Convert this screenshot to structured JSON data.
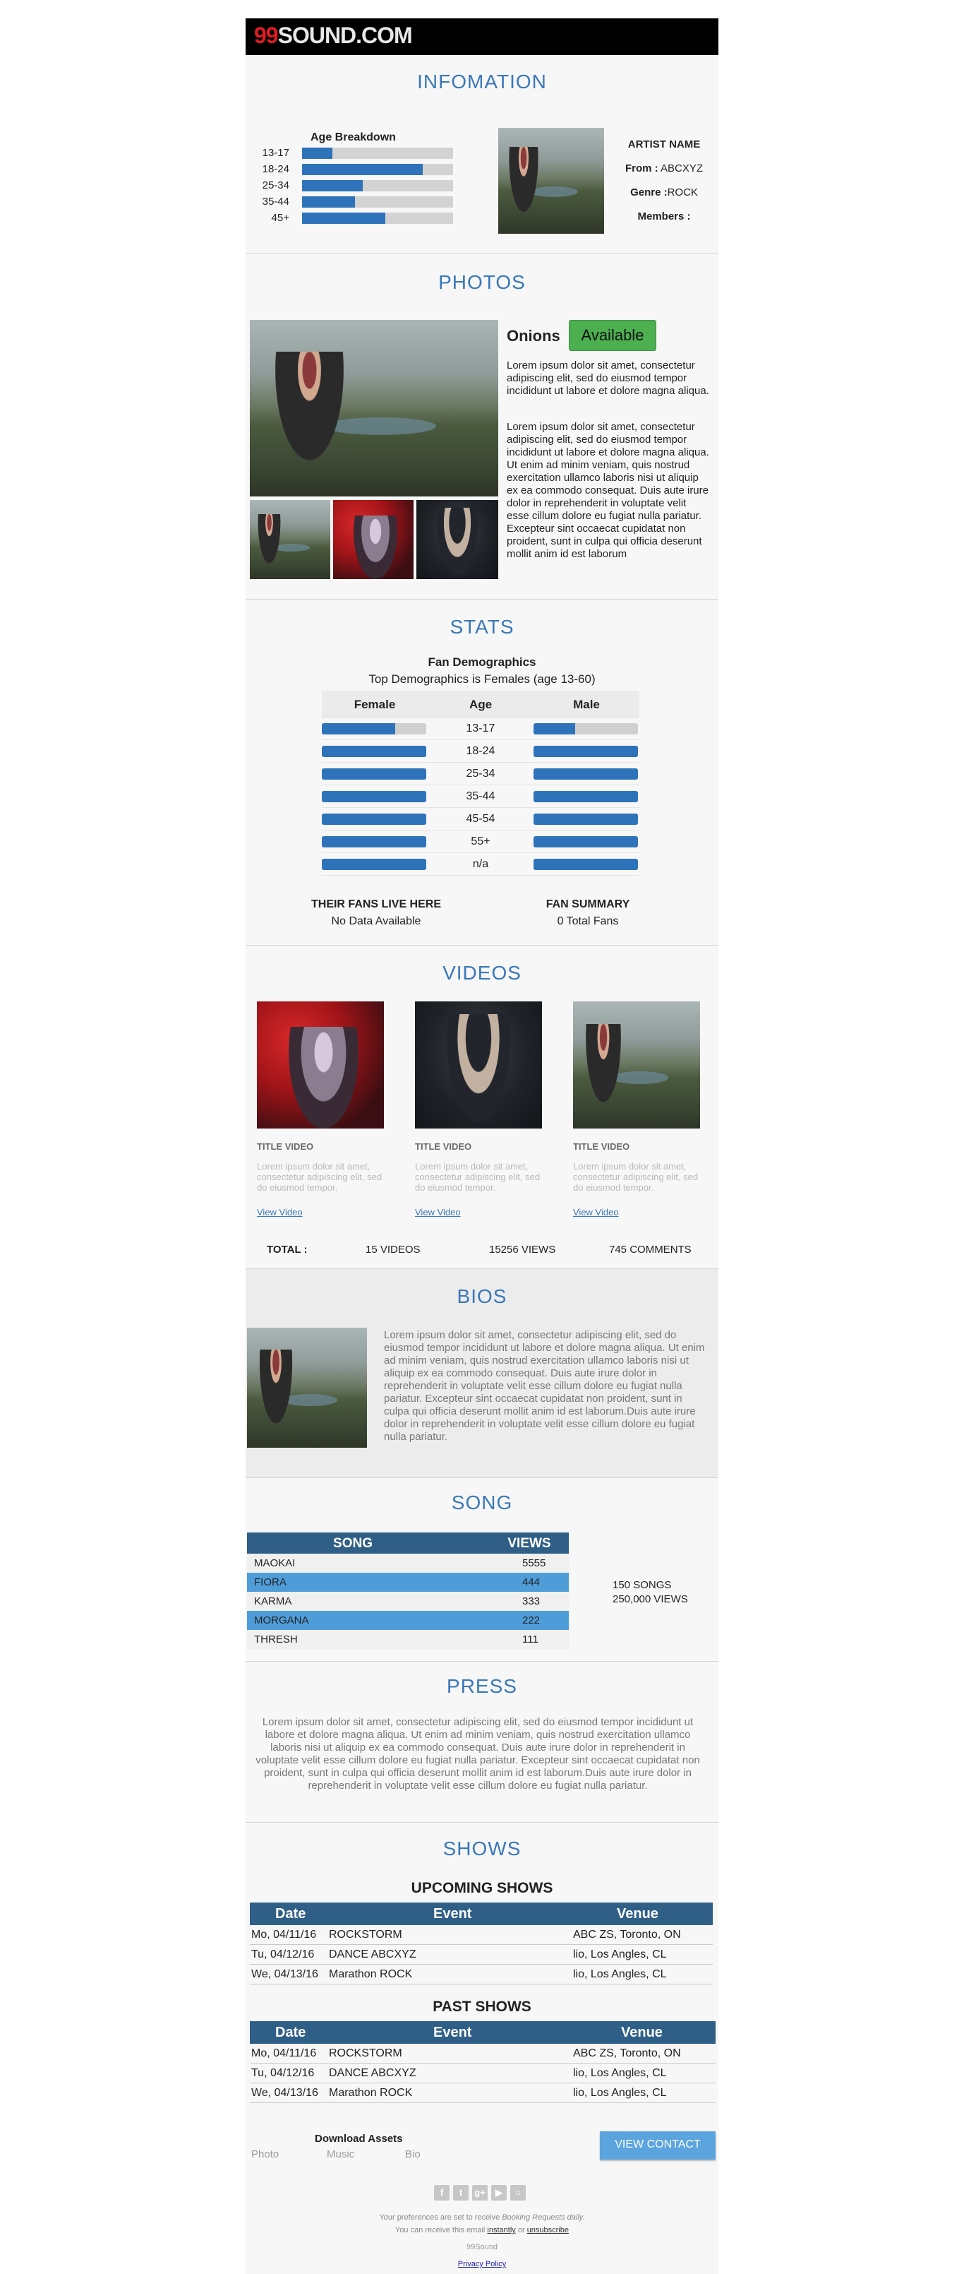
{
  "brand": {
    "digits": "99",
    "word": "SOUND.COM"
  },
  "info": {
    "title": "INFOMATION",
    "age_breakdown": {
      "title": "Age Breakdown",
      "rows": [
        {
          "label": "13-17",
          "value": 0.2
        },
        {
          "label": "18-24",
          "value": 0.8
        },
        {
          "label": "25-34",
          "value": 0.4
        },
        {
          "label": "35-44",
          "value": 0.35
        },
        {
          "label": "45+",
          "value": 0.55
        }
      ]
    },
    "artist_name": "ARTIST NAME",
    "from_label": "From :",
    "from_value": "ABCXYZ",
    "genre_label": "Genre :",
    "genre_value": "ROCK",
    "members_label": "Members :"
  },
  "photos": {
    "title": "PHOTOS",
    "name": "Onions",
    "status": "Available",
    "para1": "Lorem ipsum dolor sit amet, consectetur adipiscing elit, sed do eiusmod tempor incididunt ut labore et dolore magna aliqua.",
    "para2": "Lorem ipsum dolor sit amet, consectetur adipiscing elit, sed do eiusmod tempor incididunt ut labore et dolore magna aliqua. Ut enim ad minim veniam, quis nostrud exercitation ullamco laboris nisi ut aliquip ex ea commodo consequat. Duis aute irure dolor in reprehenderit in voluptate velit esse cillum dolore eu fugiat nulla pariatur. Excepteur sint occaecat cupidatat non proident, sunt in culpa qui officia deserunt mollit anim id est laborum"
  },
  "stats": {
    "title": "STATS",
    "heading": "Fan Demographics",
    "subheading": "Top Demographics is Females (age 13-60)",
    "col_female": "Female",
    "col_age": "Age",
    "col_male": "Male",
    "rows": [
      {
        "age": "13-17",
        "female": 0.7,
        "male": 0.4
      },
      {
        "age": "18-24",
        "female": 1.0,
        "male": 1.0
      },
      {
        "age": "25-34",
        "female": 1.0,
        "male": 1.0
      },
      {
        "age": "35-44",
        "female": 1.0,
        "male": 1.0
      },
      {
        "age": "45-54",
        "female": 1.0,
        "male": 1.0
      },
      {
        "age": "55+",
        "female": 1.0,
        "male": 1.0
      },
      {
        "age": "n/a",
        "female": 1.0,
        "male": 1.0
      }
    ],
    "fans_live_title": "THEIR FANS LIVE HERE",
    "fans_live_value": "No Data Available",
    "fan_summary_title": "FAN SUMMARY",
    "fan_summary_value": "0 Total Fans"
  },
  "videos": {
    "title": "VIDEOS",
    "items": [
      {
        "title": "TITLE VIDEO",
        "desc": "Lorem ipsum dolor sit amet, consectetur adipiscing elit, sed do eiusmod tempor.",
        "link": "View Video"
      },
      {
        "title": "TITLE VIDEO",
        "desc": "Lorem ipsum dolor sit amet, consectetur adipiscing elit, sed do eiusmod tempor.",
        "link": "View Video"
      },
      {
        "title": "TITLE VIDEO",
        "desc": "Lorem ipsum dolor sit amet, consectetur adipiscing elit, sed do eiusmod tempor.",
        "link": "View Video"
      }
    ],
    "total_label": "TOTAL :",
    "total_videos": "15 VIDEOS",
    "total_views": "15256 VIEWS",
    "total_comments": "745 COMMENTS"
  },
  "bios": {
    "title": "BIOS",
    "text": "Lorem ipsum dolor sit amet, consectetur adipiscing elit, sed do eiusmod tempor incididunt ut labore et dolore magna aliqua. Ut enim ad minim veniam, quis nostrud exercitation ullamco laboris nisi ut aliquip ex ea commodo consequat. Duis aute irure dolor in reprehenderit in voluptate velit esse cillum dolore eu fugiat nulla pariatur. Excepteur sint occaecat cupidatat non proident, sunt in culpa qui officia deserunt mollit anim id est laborum.Duis aute irure dolor in reprehenderit in voluptate velit esse cillum dolore eu fugiat nulla pariatur."
  },
  "song": {
    "title": "SONG",
    "col_song": "SONG",
    "col_views": "VIEWS",
    "rows": [
      {
        "name": "MAOKAI",
        "views": "5555"
      },
      {
        "name": "FIORA",
        "views": "444"
      },
      {
        "name": "KARMA",
        "views": "333"
      },
      {
        "name": "MORGANA",
        "views": "222"
      },
      {
        "name": "THRESH",
        "views": "111"
      }
    ],
    "summary_songs": "150 SONGS",
    "summary_views": "250,000 VIEWS"
  },
  "press": {
    "title": "PRESS",
    "text": "Lorem ipsum dolor sit amet, consectetur adipiscing elit, sed do eiusmod tempor incididunt ut labore et dolore magna aliqua. Ut enim ad minim veniam, quis nostrud exercitation ullamco laboris nisi ut aliquip ex ea commodo consequat. Duis aute irure dolor in reprehenderit in voluptate velit esse cillum dolore eu fugiat nulla pariatur. Excepteur sint occaecat cupidatat non proident, sunt in culpa qui officia deserunt mollit anim id est laborum.Duis aute irure dolor in reprehenderit in voluptate velit esse cillum dolore eu fugiat nulla pariatur."
  },
  "shows": {
    "title": "SHOWS",
    "upcoming_title": "UPCOMING SHOWS",
    "past_title": "PAST SHOWS",
    "col_date": "Date",
    "col_event": "Event",
    "col_venue": "Venue",
    "upcoming": [
      {
        "date": "Mo, 04/11/16",
        "event": "ROCKSTORM",
        "venue": "ABC ZS, Toronto, ON"
      },
      {
        "date": "Tu, 04/12/16",
        "event": "DANCE ABCXYZ",
        "venue": "lio, Los Angles, CL"
      },
      {
        "date": "We, 04/13/16",
        "event": "Marathon ROCK",
        "venue": "lio, Los Angles, CL"
      }
    ],
    "past": [
      {
        "date": "Mo, 04/11/16",
        "event": "ROCKSTORM",
        "venue": "ABC ZS, Toronto, ON"
      },
      {
        "date": "Tu, 04/12/16",
        "event": "DANCE ABCXYZ",
        "venue": "lio, Los Angles, CL"
      },
      {
        "date": "We, 04/13/16",
        "event": "Marathon ROCK",
        "venue": "lio, Los Angles, CL"
      }
    ]
  },
  "footer": {
    "download_title": "Download Assets",
    "asset_photo": "Photo",
    "asset_music": "Music",
    "asset_bio": "Bio",
    "contact_button": "VIEW CONTACT",
    "pref_prefix": "Your preferences are set to receive ",
    "pref_item": "Booking Requests daily.",
    "receive_prefix": "You can receive this email ",
    "receive_instantly": "instantly",
    "receive_or": " or ",
    "receive_unsubscribe": "unsubscribe",
    "company": "99Sound",
    "privacy": "Privacy Policy",
    "social_icons": [
      "facebook-icon",
      "twitter-icon",
      "google-plus-icon",
      "youtube-icon",
      "instagram-icon"
    ]
  }
}
